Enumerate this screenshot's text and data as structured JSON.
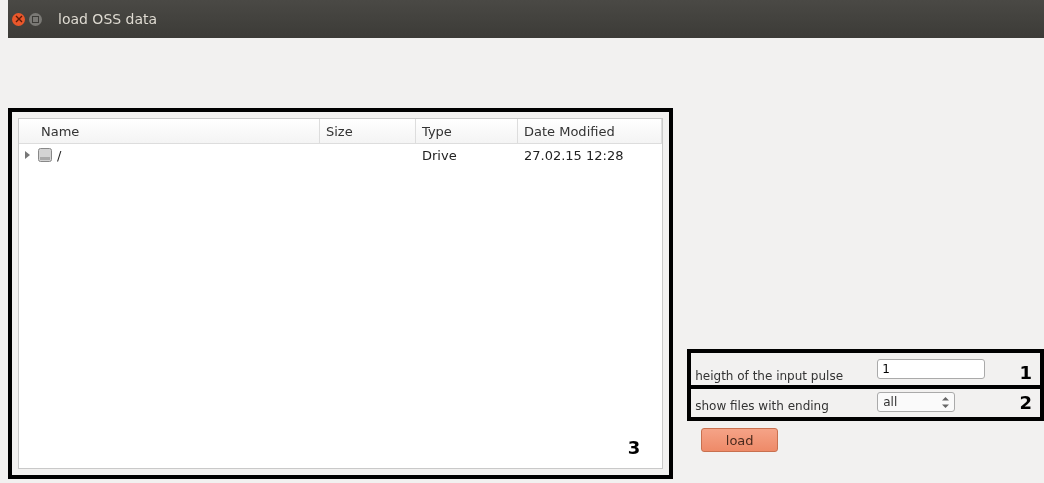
{
  "window": {
    "title": "load OSS data"
  },
  "file_tree": {
    "columns": [
      "Name",
      "Size",
      "Type",
      "Date Modified"
    ],
    "rows": [
      {
        "name": "/",
        "size": "",
        "type": "Drive",
        "date_modified": "27.02.15 12:28",
        "expanded": false
      }
    ],
    "annotation": "3"
  },
  "pulse_height": {
    "label": "heigth of the input pulse",
    "value": "1",
    "annotation": "1"
  },
  "file_ending": {
    "label": "show files with ending",
    "value": "all",
    "annotation": "2"
  },
  "load_button": "load"
}
